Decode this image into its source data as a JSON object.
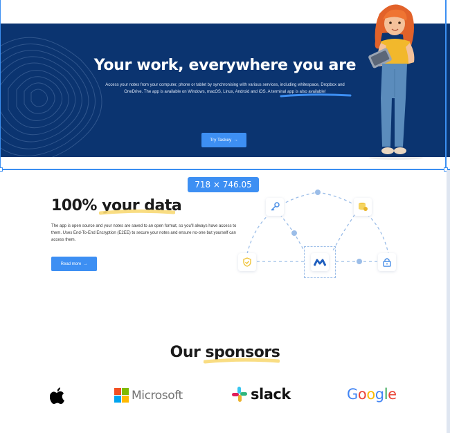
{
  "hero": {
    "title_prefix": "Your work, everywhere ",
    "title_highlight": "you are",
    "description": "Access your notes from your computer, phone or tablet by synchronising with various services, including whitespace, Dropbox and OneDrive. The app is available on Windows, macOS, Linux, Android and iOS. A terminal app is also available!",
    "button_label": "Try Taskey",
    "button_arrow": "→"
  },
  "selection": {
    "dimensions_label": "718 × 746.05"
  },
  "data_section": {
    "title_prefix": "100% ",
    "title_highlight": "your data",
    "description": "The app is open source and your notes are saved to an open format, so you'll always have access to them. Uses End-To-End Encryption (E2EE) to secure your notes and ensure no-one but yourself can access them.",
    "button_label": "Read more",
    "button_arrow": "→",
    "diagram_nodes": [
      "key-icon",
      "database-icon",
      "shield-check-icon",
      "app-logo-icon",
      "lock-icon"
    ]
  },
  "sponsors": {
    "title_prefix": "Our ",
    "title_highlight": "sponsors",
    "logos": {
      "apple": "apple-logo",
      "microsoft": "Microsoft",
      "slack": "slack",
      "google": [
        "G",
        "o",
        "o",
        "g",
        "l",
        "e"
      ]
    }
  },
  "colors": {
    "hero_background": "#0b3470",
    "accent": "#3d8ff3",
    "highlight_underline": "#f8d976",
    "hero_underline": "#3d8ff3",
    "google": [
      "#4285F4",
      "#EA4335",
      "#FBBC05",
      "#4285F4",
      "#34A853",
      "#EA4335"
    ]
  }
}
